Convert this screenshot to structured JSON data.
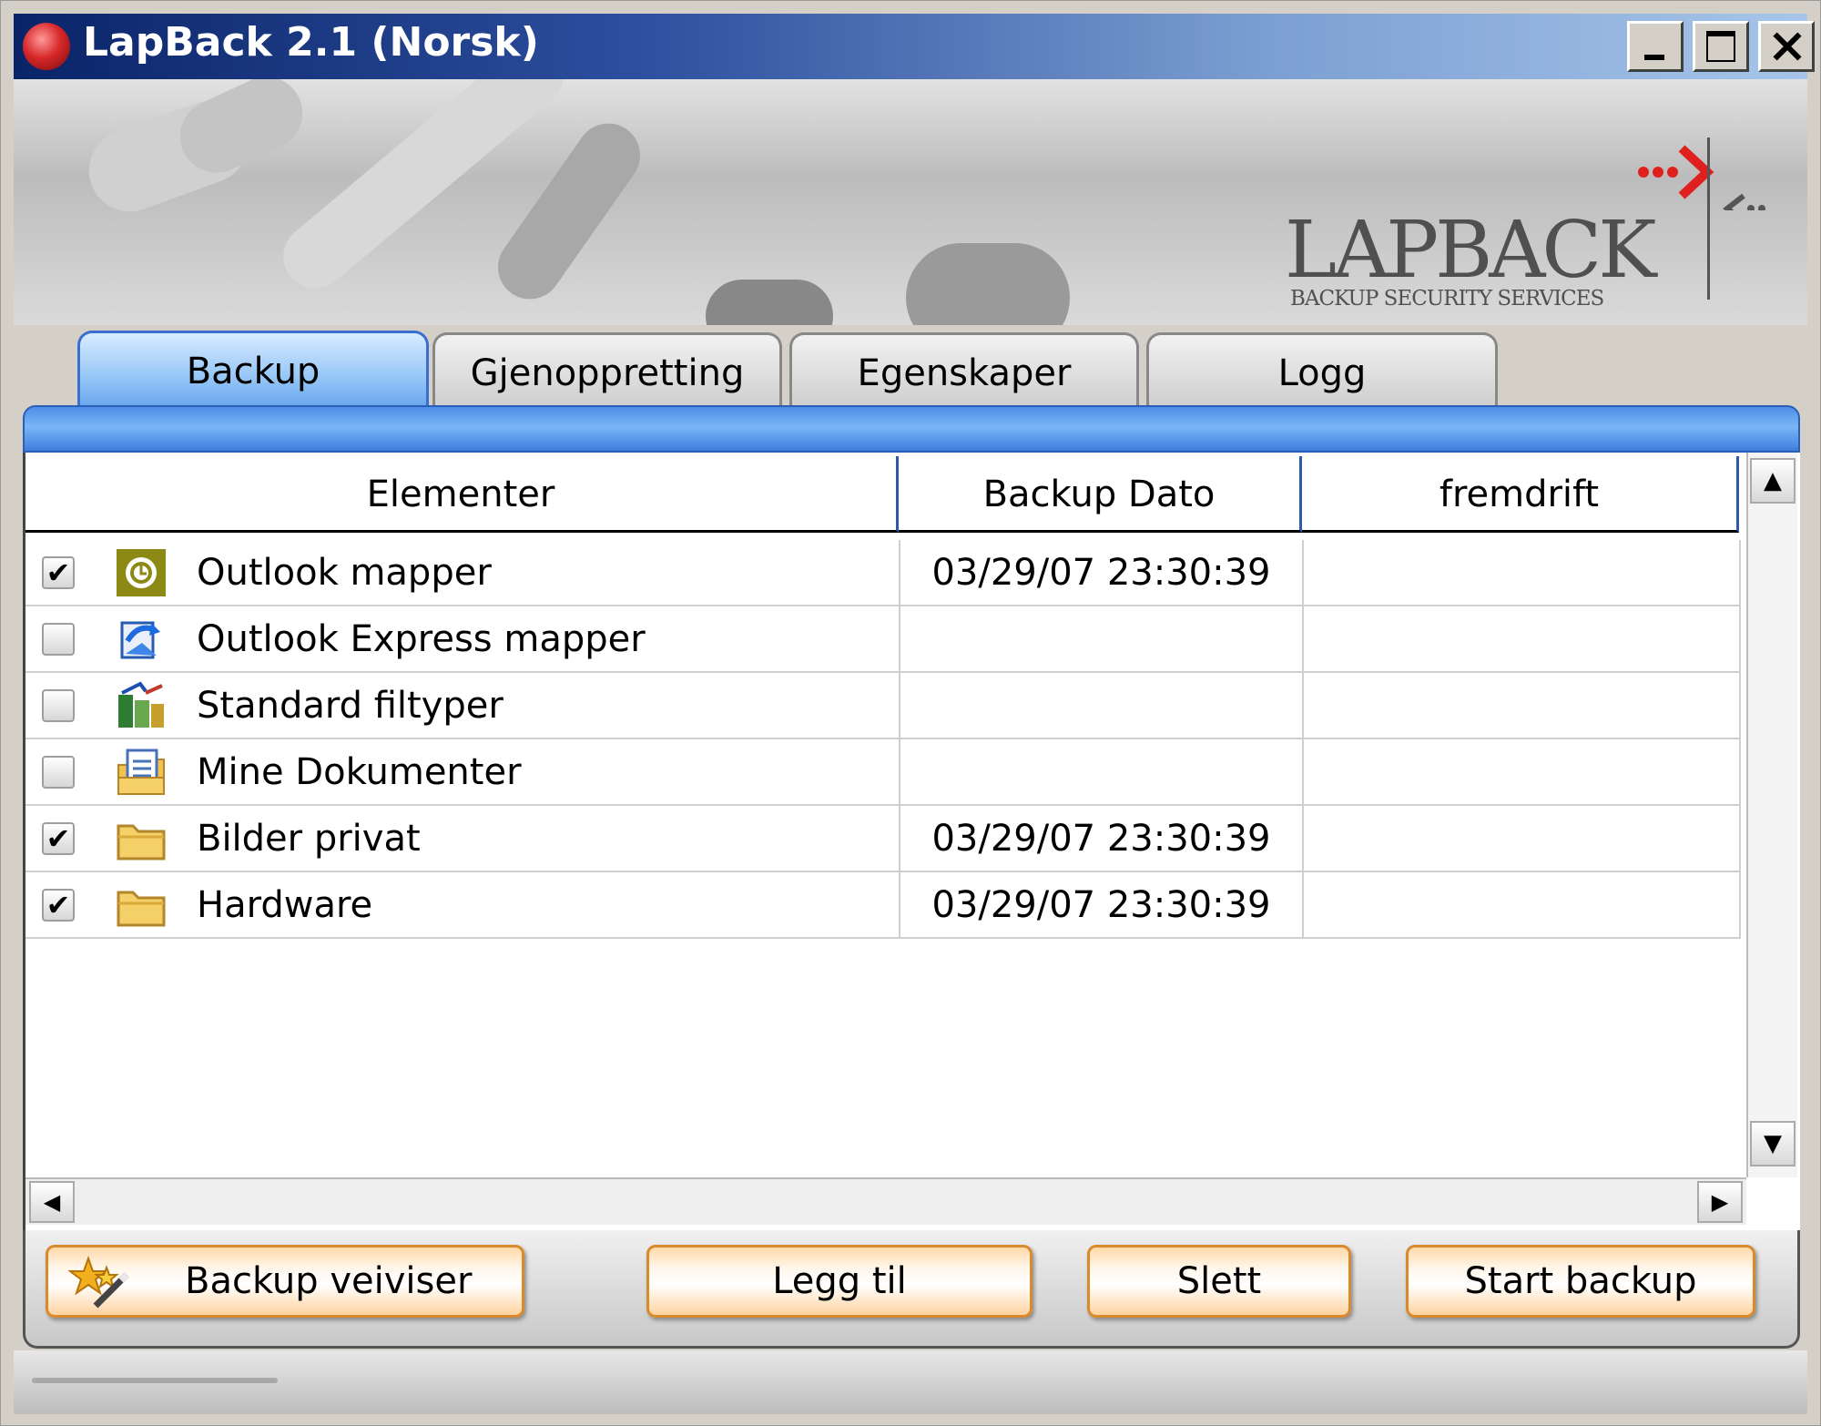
{
  "window": {
    "title": "LapBack 2.1 (Norsk)"
  },
  "banner": {
    "logo_main": "LAPBACK",
    "logo_sub": "BACKUP SECURITY SERVICES",
    "accent": "#e0201e"
  },
  "tabs": [
    "Backup",
    "Gjenoppretting",
    "Egenskaper",
    "Logg"
  ],
  "active_tab": "Backup",
  "table": {
    "columns": [
      "Elementer",
      "Backup Dato",
      "fremdrift"
    ],
    "rows": [
      {
        "checked": "✔",
        "icon": "outlook-icon",
        "name": "Outlook mapper",
        "date": "03/29/07 23:30:39",
        "progress": ""
      },
      {
        "checked": "",
        "icon": "outlook-express-icon",
        "name": "Outlook Express mapper",
        "date": "",
        "progress": ""
      },
      {
        "checked": "",
        "icon": "file-types-icon",
        "name": "Standard filtyper",
        "date": "",
        "progress": ""
      },
      {
        "checked": "",
        "icon": "documents-icon",
        "name": "Mine Dokumenter",
        "date": "",
        "progress": ""
      },
      {
        "checked": "✔",
        "icon": "folder-icon",
        "name": "Bilder privat",
        "date": "03/29/07 23:30:39",
        "progress": ""
      },
      {
        "checked": "✔",
        "icon": "folder-icon",
        "name": "Hardware",
        "date": "03/29/07 23:30:39",
        "progress": ""
      }
    ]
  },
  "scroll": {
    "up": "▲",
    "down": "▼",
    "left": "◀",
    "right": "▶"
  },
  "buttons": {
    "wizard": "Backup veiviser",
    "add": "Legg til",
    "delete": "Slett",
    "start": "Start backup"
  },
  "colors": {
    "titlebar_start": "#0a2468",
    "tab_active": "#5d9eea",
    "button_border": "#d88a2e"
  }
}
